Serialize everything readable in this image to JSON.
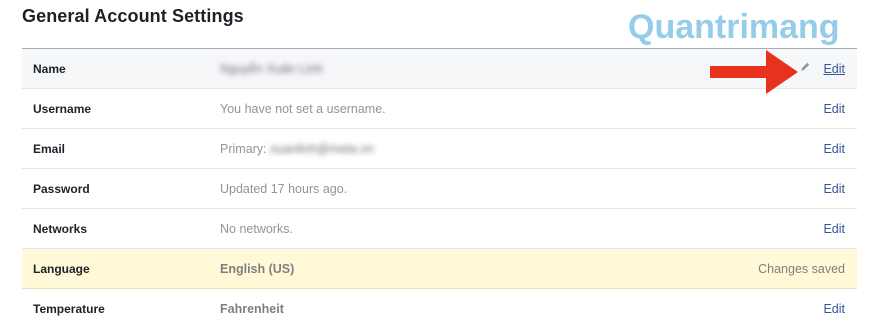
{
  "page": {
    "title": "General Account Settings"
  },
  "watermark": {
    "brand": "Quantrimang"
  },
  "settings": [
    {
      "label": "Name",
      "value_prefix": "",
      "value": "Nguyễn Xuân Linh",
      "action": "Edit",
      "value_blurred": true
    },
    {
      "label": "Username",
      "value_prefix": "",
      "value": "You have not set a username.",
      "action": "Edit",
      "value_blurred": false
    },
    {
      "label": "Email",
      "value_prefix": "Primary:",
      "value": "xuanlinh@meta.vn",
      "action": "Edit",
      "value_blurred": true
    },
    {
      "label": "Password",
      "value_prefix": "",
      "value": "Updated 17 hours ago.",
      "action": "Edit",
      "value_blurred": false
    },
    {
      "label": "Networks",
      "value_prefix": "",
      "value": "No networks.",
      "action": "Edit",
      "value_blurred": false
    },
    {
      "label": "Language",
      "value_prefix": "",
      "value": "English (US)",
      "action": "Changes saved",
      "value_blurred": false
    },
    {
      "label": "Temperature",
      "value_prefix": "",
      "value": "Fahrenheit",
      "action": "Edit",
      "value_blurred": false
    }
  ],
  "colors": {
    "link": "#365899",
    "highlight_row": "#fff9d7",
    "annotation_arrow": "#e8321e",
    "watermark": "#3da3d8"
  },
  "icons": {
    "edit": "pencil-icon",
    "annotation": "red-arrow-icon"
  }
}
